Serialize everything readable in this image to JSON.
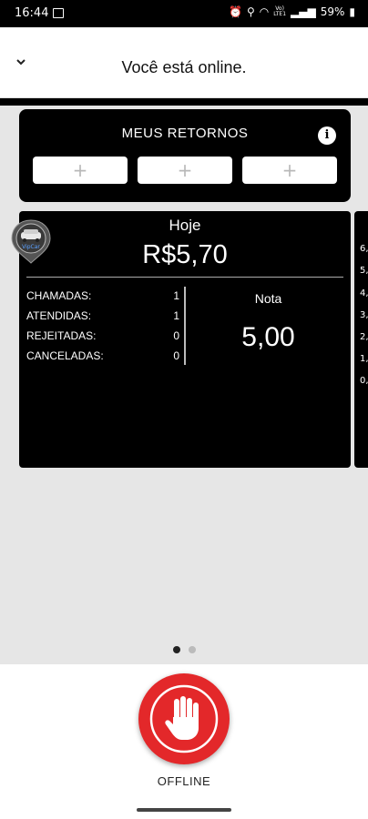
{
  "status_bar": {
    "time": "16:44",
    "battery": "59%",
    "network_line1": "Vo)",
    "network_line2": "LTE1",
    "icons": [
      "image-icon",
      "alarm-icon",
      "location-icon",
      "wifi-icon",
      "signal-icon",
      "battery-icon"
    ]
  },
  "header": {
    "title": "Você está online.",
    "collapse_icon": "chevron-down-icon"
  },
  "returns_card": {
    "title": "MEUS RETORNOS",
    "info_icon": "info-icon",
    "slots": [
      "+",
      "+",
      "+"
    ]
  },
  "today_card": {
    "label": "Hoje",
    "value": "R$5,70",
    "logo_text": "VipCar",
    "stats": [
      {
        "label": "CHAMADAS:",
        "value": "1"
      },
      {
        "label": "ATENDIDAS:",
        "value": "1"
      },
      {
        "label": "REJEITADAS:",
        "value": "0"
      },
      {
        "label": "CANCELADAS:",
        "value": "0"
      }
    ],
    "rating_label": "Nota",
    "rating_value": "5,00"
  },
  "next_card": {
    "ticks": [
      "6,",
      "5,",
      "4,",
      "3,",
      "2,",
      "1,",
      "0,"
    ]
  },
  "pager": {
    "count": 2,
    "active_index": 0
  },
  "footer": {
    "button_label": "OFFLINE",
    "button_icon": "hand-stop-icon",
    "button_color": "#e3282a"
  }
}
